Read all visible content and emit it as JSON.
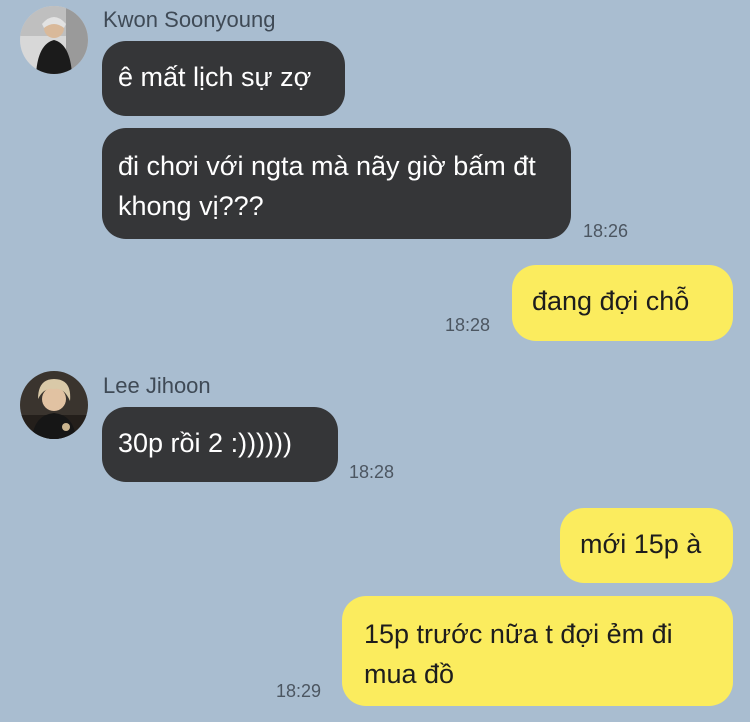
{
  "chat": {
    "messages": [
      {
        "sender": "Kwon Soonyoung",
        "text": "ê mất lịch sự zợ"
      },
      {
        "text": "đi chơi với ngta mà nãy giờ bấm đt khong vị???",
        "time": "18:26"
      },
      {
        "text": "đang đợi chỗ",
        "time": "18:28"
      },
      {
        "sender": "Lee Jihoon",
        "text": "30p rồi 2 :))))))",
        "time": "18:28"
      },
      {
        "text": "mới 15p à"
      },
      {
        "text": "15p trước nữa t đợi ẻm đi mua đồ",
        "time": "18:29"
      }
    ]
  },
  "colors": {
    "background": "#a9bdd0",
    "incoming_bubble": "#353638",
    "outgoing_bubble": "#fbec5e"
  }
}
